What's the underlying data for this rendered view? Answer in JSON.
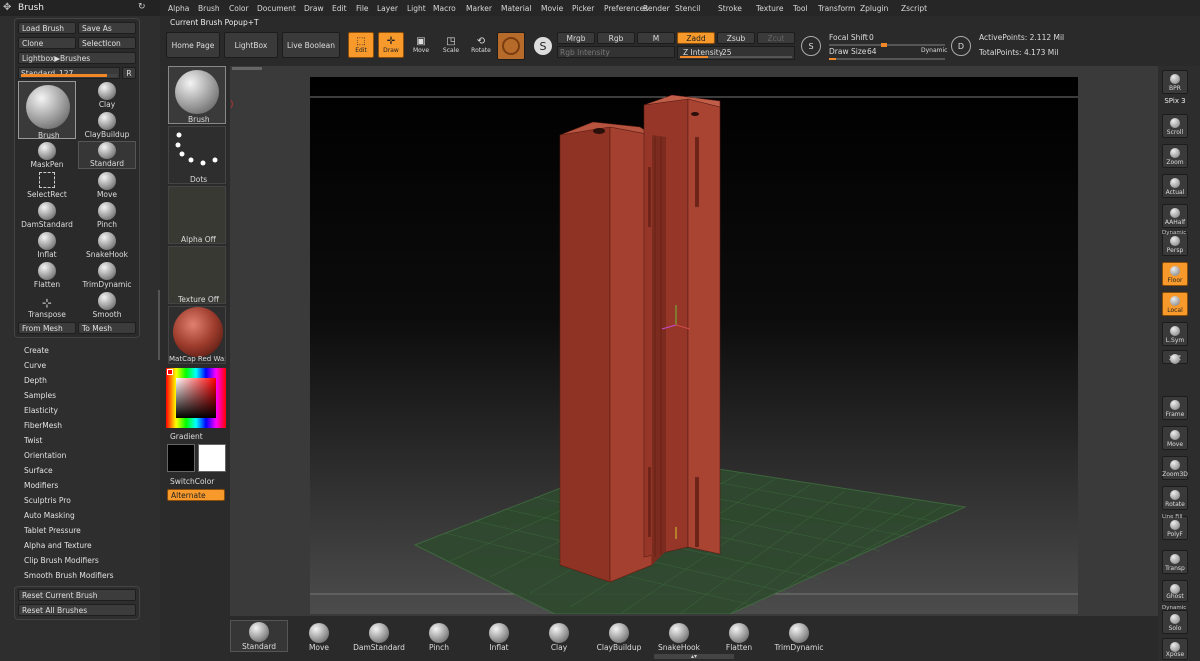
{
  "palette": {
    "title": "Brush",
    "buttons": {
      "load_brush": "Load Brush",
      "save_as": "Save As",
      "clone": "Clone",
      "select_icon": "SelectIcon",
      "lightbox_brushes": "Lightbox▶Brushes",
      "standard_label": "Standard.",
      "standard_value": "127",
      "r": "R",
      "from_mesh": "From Mesh",
      "to_mesh": "To Mesh",
      "reset_current": "Reset Current Brush",
      "reset_all": "Reset All Brushes"
    },
    "brushes": [
      "Brush",
      "Clay",
      "ClayBuildup",
      "MaskPen",
      "Standard",
      "SelectRect",
      "Move",
      "DamStandard",
      "Pinch",
      "Inflat",
      "SnakeHook",
      "Flatten",
      "TrimDynamic",
      "Transpose",
      "Smooth"
    ],
    "subpalettes": [
      "Create",
      "Curve",
      "Depth",
      "Samples",
      "Elasticity",
      "FiberMesh",
      "Twist",
      "Orientation",
      "Surface",
      "Modifiers",
      "Sculptris Pro",
      "Auto Masking",
      "Tablet Pressure",
      "Alpha and Texture",
      "Clip Brush Modifiers",
      "Smooth Brush Modifiers"
    ]
  },
  "top_menu": [
    "Alpha",
    "Brush",
    "Color",
    "Document",
    "Draw",
    "Edit",
    "File",
    "Layer",
    "Light",
    "Macro",
    "Marker",
    "Material",
    "Movie",
    "Picker",
    "Preferences",
    "Render",
    "Stencil",
    "Stroke",
    "Texture",
    "Tool",
    "Transform",
    "Zplugin",
    "Zscript"
  ],
  "toolbar": {
    "popup_label": "Current Brush Popup+T",
    "home_page": "Home Page",
    "lightbox": "LightBox",
    "live_boolean": "Live Boolean",
    "edit": "Edit",
    "draw": "Draw",
    "move": "Move",
    "scale": "Scale",
    "rotate": "Rotate",
    "mrgb": "Mrgb",
    "rgb": "Rgb",
    "m": "M",
    "zadd": "Zadd",
    "zsub": "Zsub",
    "zcut": "Zcut",
    "rgb_intensity": "Rgb Intensity",
    "z_intensity_label": "Z Intensity",
    "z_intensity_value": "25",
    "focal_shift_label": "Focal Shift",
    "focal_shift_value": "0",
    "draw_size_label": "Draw Size",
    "draw_size_value": "64",
    "dynamic": "Dynamic",
    "active_points": "ActivePoints: 2.112 Mil",
    "total_points": "TotalPoints: 4.173 Mil",
    "s_label": "S",
    "d_label": "D",
    "z_intensity_level": 0.25,
    "draw_size_level": 0.06,
    "standard_level": 0.9
  },
  "tray": {
    "brush": "Brush",
    "dots": "Dots",
    "alpha": "Alpha Off",
    "texture": "Texture Off",
    "material": "MatCap Red Wax",
    "gradient": "Gradient",
    "switch_color": "SwitchColor",
    "alternate": "Alternate"
  },
  "right_shelf": [
    "BPR",
    "SPix 3",
    "Scroll",
    "Zoom",
    "Actual",
    "AAHalf",
    "Dynamic",
    "Persp",
    "Floor",
    "Local",
    "L.Sym",
    "XYZ",
    "Frame",
    "Move",
    "Zoom3D",
    "Rotate",
    "Line Fill",
    "PolyF",
    "Transp",
    "Ghost",
    "Dynamic",
    "Solo",
    "Xpose"
  ],
  "bottom_shelf": [
    "Standard",
    "Move",
    "DamStandard",
    "Pinch",
    "Inflat",
    "Clay",
    "ClayBuildup",
    "SnakeHook",
    "Flatten",
    "TrimDynamic"
  ],
  "colors": {
    "accent": "#f89a2b",
    "model": "#9c3b2c",
    "floor_grid": "#3f6b3f"
  }
}
